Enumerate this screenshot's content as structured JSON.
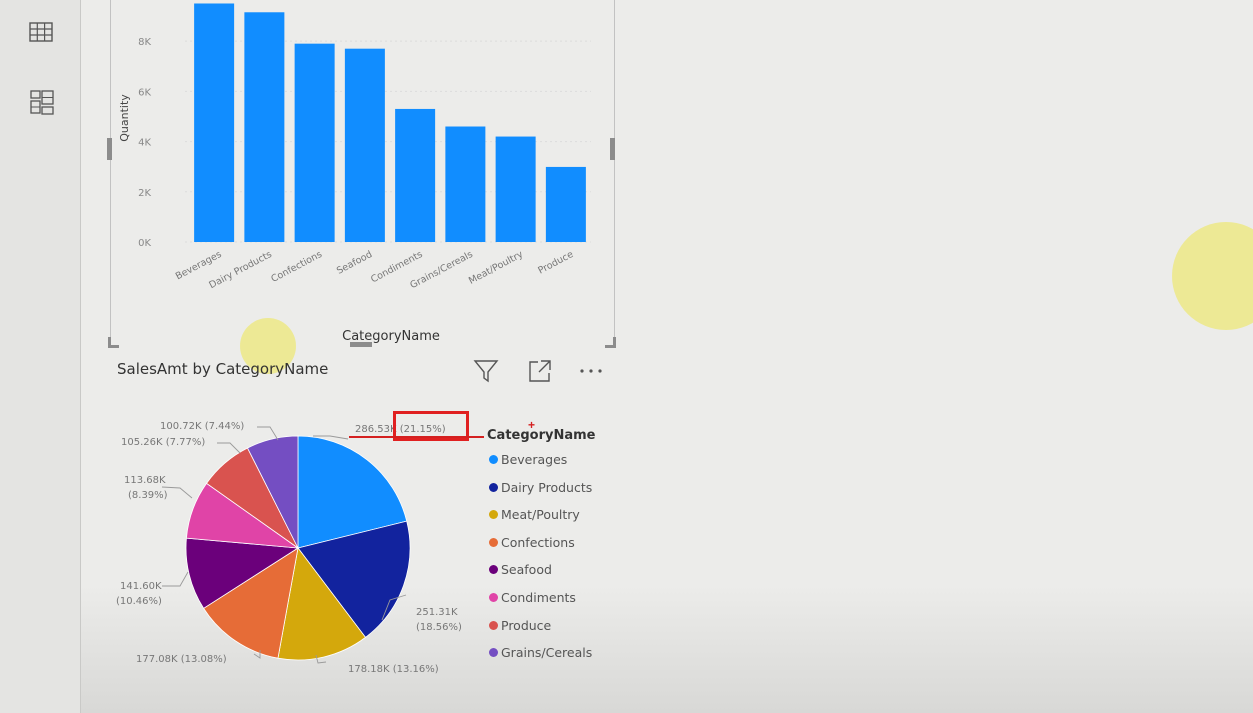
{
  "sidebar": {
    "items": [
      {
        "name": "table-view-icon"
      },
      {
        "name": "model-view-icon"
      }
    ]
  },
  "bar_chart": {
    "chart_data": {
      "type": "bar",
      "categories": [
        "Beverages",
        "Dairy Products",
        "Confections",
        "Seafood",
        "Condiments",
        "Grains/Cereals",
        "Meat/Poultry",
        "Produce"
      ],
      "values": [
        9500,
        9150,
        7900,
        7700,
        5300,
        4600,
        4200,
        2990
      ],
      "ylabel": "Quantity",
      "xlabel": "CategoryName",
      "yticks": [
        "0K",
        "2K",
        "4K",
        "6K",
        "8K"
      ],
      "ylim": [
        0,
        9400
      ],
      "grid": true,
      "color": "#118dff"
    }
  },
  "pie_chart": {
    "title": "SalesAmt by CategoryName",
    "chart_data": {
      "type": "pie",
      "legend_title": "CategoryName",
      "legend_position": "right",
      "slices": [
        {
          "name": "Beverages",
          "label": "286.53K (21.15%)",
          "percent": 21.15,
          "color": "#118dff"
        },
        {
          "name": "Dairy Products",
          "label": "251.31K (18.56%)",
          "percent": 18.56,
          "color": "#12239e"
        },
        {
          "name": "Meat/Poultry",
          "label": "178.18K (13.16%)",
          "percent": 13.16,
          "color": "#d4a80c"
        },
        {
          "name": "Confections",
          "label": "177.08K (13.08%)",
          "percent": 13.08,
          "color": "#e66c37"
        },
        {
          "name": "Seafood",
          "label": "141.60K (10.46%)",
          "percent": 10.46,
          "color": "#6b007b"
        },
        {
          "name": "Condiments",
          "label": "113.68K (8.39%)",
          "percent": 8.39,
          "color": "#e044a7"
        },
        {
          "name": "Produce",
          "label": "105.26K (7.77%)",
          "percent": 7.77,
          "color": "#d9534f"
        },
        {
          "name": "Grains/Cereals",
          "label": "100.72K (7.44%)",
          "percent": 7.44,
          "color": "#744ec2"
        }
      ]
    },
    "label_lines": {
      "beverages": "286.53K (21.15%)",
      "dairy_1": "251.31K",
      "dairy_2": "(18.56%)",
      "meat": "178.18K (13.16%)",
      "confections": "177.08K (13.08%)",
      "seafood_1": "141.60K",
      "seafood_2": "(10.46%)",
      "condiments_1": "113.68K",
      "condiments_2": "(8.39%)",
      "produce": "105.26K (7.77%)",
      "grains": "100.72K (7.44%)"
    }
  }
}
